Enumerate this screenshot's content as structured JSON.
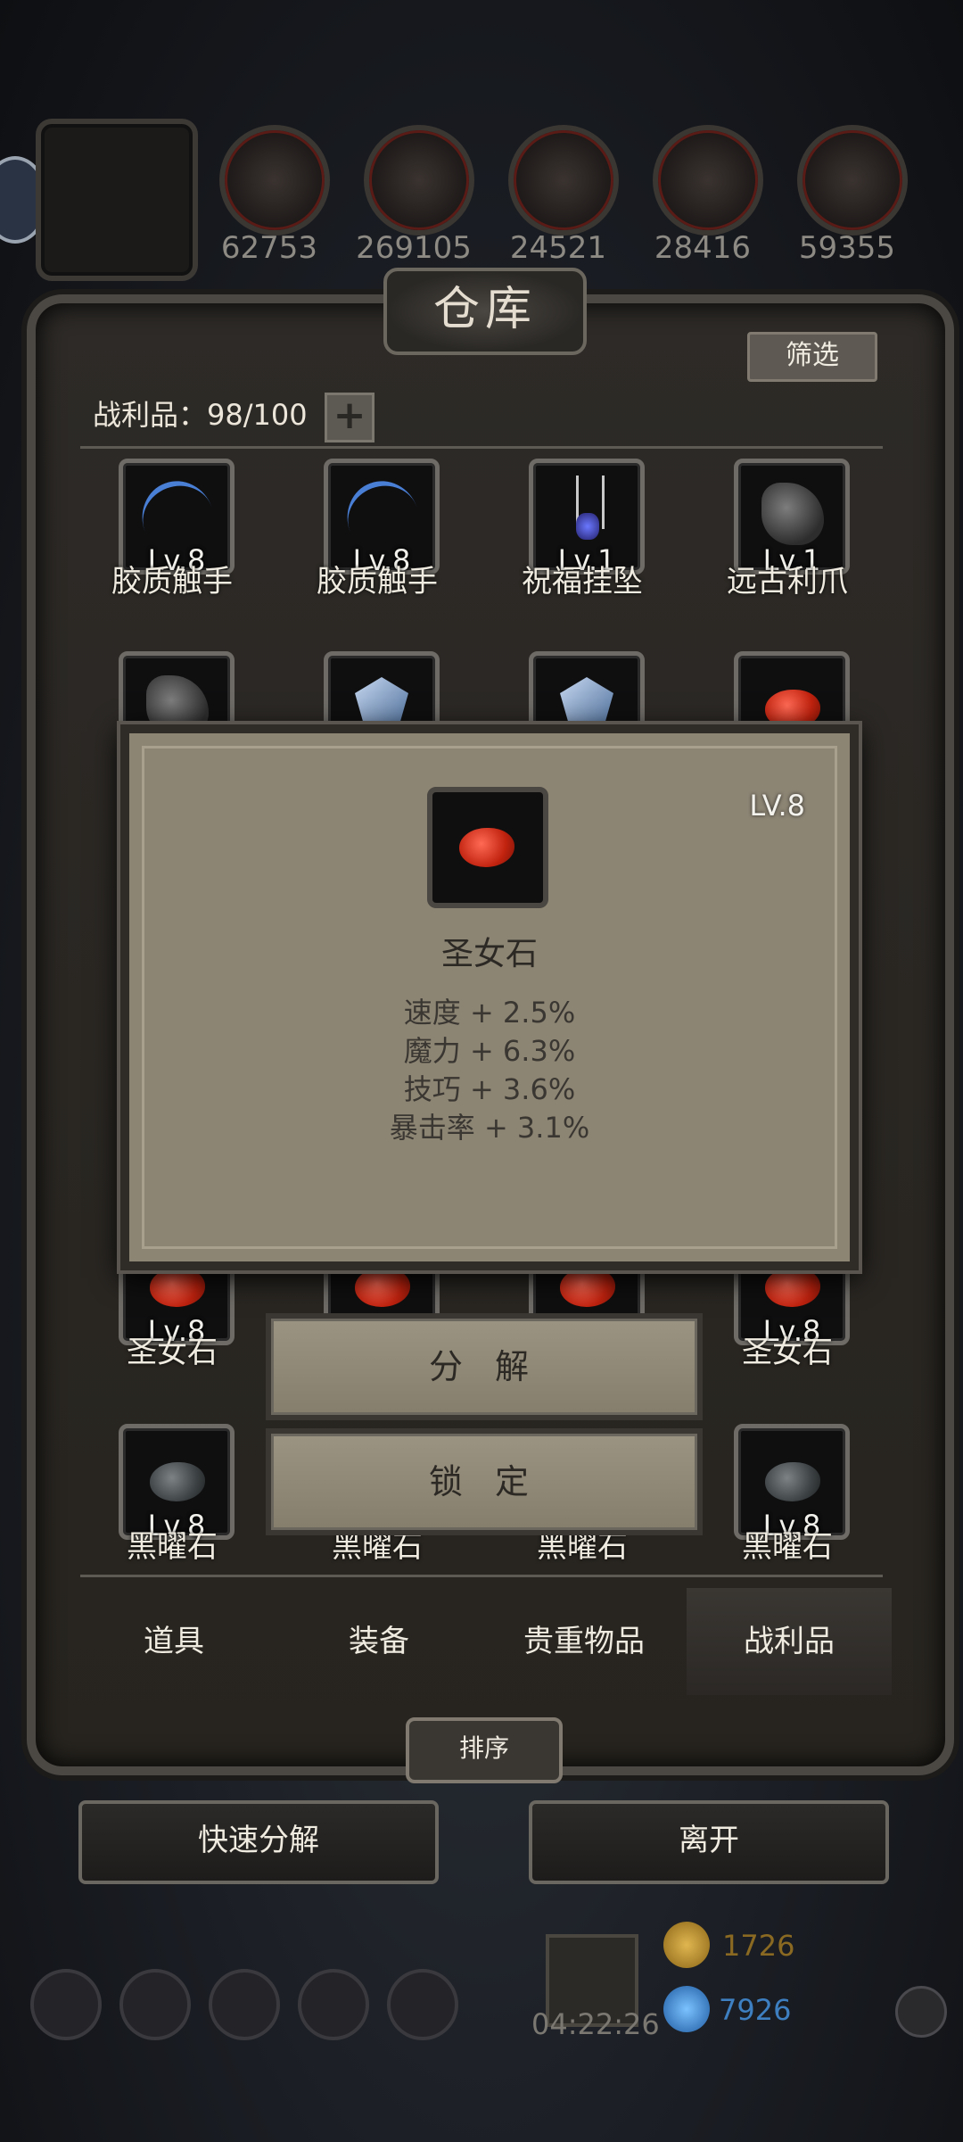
{
  "resources": {
    "counts": [
      "62753",
      "269105",
      "24521",
      "28416",
      "59355"
    ]
  },
  "warehouse": {
    "title": "仓库",
    "filter_label": "筛选",
    "loot_label": "战利品：98/100",
    "plus_label": "+"
  },
  "items": {
    "row1": [
      {
        "level": "Lv.8",
        "name": "胶质触手",
        "icon": "tentacle-icon"
      },
      {
        "level": "Lv.8",
        "name": "胶质触手",
        "icon": "tentacle-icon"
      },
      {
        "level": "Lv.1",
        "name": "祝福挂坠",
        "icon": "pendant-icon"
      },
      {
        "level": "Lv.1",
        "name": "远古利爪",
        "icon": "claw-icon"
      }
    ],
    "row3": [
      {
        "level": "Lv.8",
        "name": "圣女石",
        "icon": "red-gem-icon"
      },
      {
        "level": "",
        "name": "",
        "icon": "red-gem-icon"
      },
      {
        "level": "",
        "name": "",
        "icon": "red-gem-icon"
      },
      {
        "level": "Lv.8",
        "name": "圣女石",
        "icon": "red-gem-icon"
      }
    ],
    "row4": [
      {
        "level": "Lv.8",
        "name": "黑曜石",
        "icon": "black-gem-icon"
      },
      {
        "level": "",
        "name": "黑曜石",
        "icon": "black-gem-icon"
      },
      {
        "level": "",
        "name": "黑曜石",
        "icon": "black-gem-icon"
      },
      {
        "level": "Lv.8",
        "name": "黑曜石",
        "icon": "black-gem-icon"
      }
    ]
  },
  "popup": {
    "level": "LV.8",
    "name": "圣女石",
    "stats": [
      "速度 + 2.5%",
      "魔力 + 6.3%",
      "技巧 + 3.6%",
      "暴击率 + 3.1%"
    ],
    "decompose_label": "分 解",
    "lock_label": "锁 定"
  },
  "tabs": [
    "道具",
    "装备",
    "贵重物品",
    "战利品"
  ],
  "active_tab": "战利品",
  "sort_label": "排序",
  "quick_decompose_label": "快速分解",
  "leave_label": "离开",
  "hud": {
    "timer": "04:22:26",
    "gold": "1726",
    "gems": "7926"
  },
  "colors": {
    "gold": "#b58a2a",
    "gem_blue": "#3d8fd9",
    "red_gem": "#c1230f"
  }
}
